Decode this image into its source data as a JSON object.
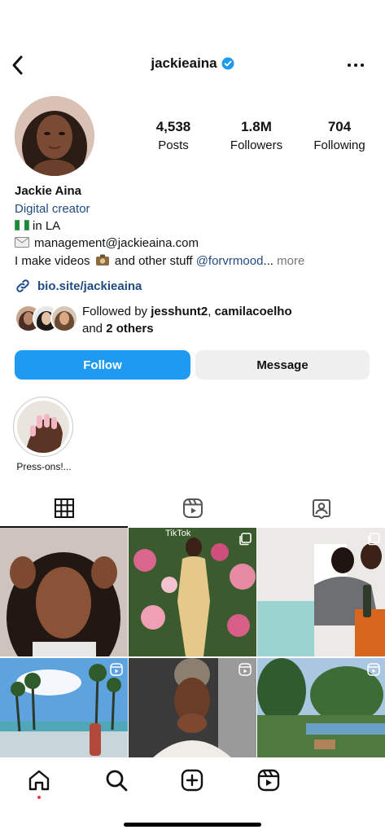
{
  "header": {
    "username": "jackieaina",
    "verified": true,
    "icons": {
      "back": "chevron-left-icon",
      "more": "more-horizontal-icon",
      "verified": "verified-badge-icon"
    }
  },
  "profile": {
    "stats": [
      {
        "value": "4,538",
        "label": "Posts"
      },
      {
        "value": "1.8M",
        "label": "Followers"
      },
      {
        "value": "704",
        "label": "Following"
      }
    ],
    "name": "Jackie Aina",
    "category": "Digital creator",
    "location": "in LA",
    "email": "management@jackieaina.com",
    "bio_prefix": "I make videos",
    "bio_mid": "and other stuff",
    "bio_mention": "@forvrmood",
    "bio_ellipsis": "...",
    "bio_more": "more",
    "link": "bio.site/jackieaina",
    "followed_by_prefix": "Followed by ",
    "followed_by_user1": "jesshunt2",
    "followed_by_sep": ", ",
    "followed_by_user2": "camilacoelho",
    "followed_by_and": "and ",
    "followed_by_others": "2 others"
  },
  "actions": {
    "follow": "Follow",
    "message": "Message"
  },
  "highlights": [
    {
      "label": "Press-ons!..."
    }
  ],
  "tabs": [
    {
      "icon": "grid-icon",
      "active": true
    },
    {
      "icon": "reels-icon",
      "active": false
    },
    {
      "icon": "tagged-icon",
      "active": false
    }
  ],
  "grid_posts": [
    {
      "type": "photo"
    },
    {
      "type": "carousel"
    },
    {
      "type": "carousel"
    },
    {
      "type": "photo"
    },
    {
      "type": "reel"
    },
    {
      "type": "reel"
    }
  ],
  "grid_overlay_text": "TikTok",
  "bottom_nav": [
    {
      "icon": "home-icon",
      "active": true
    },
    {
      "icon": "search-icon"
    },
    {
      "icon": "create-icon"
    },
    {
      "icon": "reels-icon"
    }
  ],
  "colors": {
    "accent": "#1e9bf0",
    "link": "#1f4b84",
    "notification_dot": "#e23c4f"
  }
}
